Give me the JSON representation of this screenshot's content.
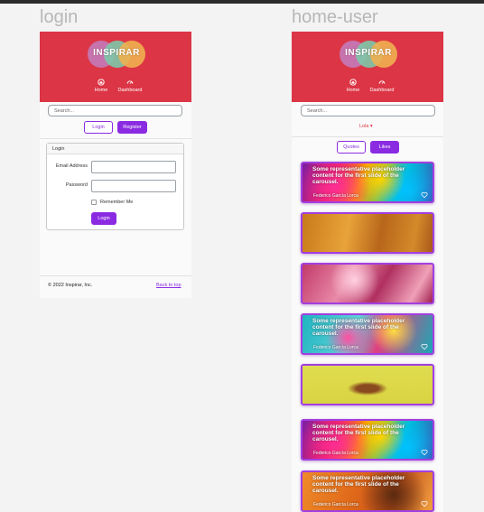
{
  "frames": {
    "login": {
      "title": "login"
    },
    "home": {
      "title": "home-user"
    }
  },
  "brand": {
    "logo_text": "INSPIRAR",
    "colors": {
      "hero": "#dc3545",
      "accent": "#8a2be2"
    }
  },
  "nav": {
    "home_label": "Home",
    "dashboard_label": "Dashboard"
  },
  "search": {
    "placeholder": "Search..."
  },
  "login_page": {
    "login_button": "Login",
    "register_button": "Register",
    "form": {
      "header": "Login",
      "email_label": "Email Address",
      "password_label": "Password",
      "remember_label": "Remember Me",
      "submit_label": "Login"
    },
    "footer": {
      "copyright": "© 2022 Inspirar, Inc.",
      "back_to_top": "Back to top"
    }
  },
  "home_page": {
    "user_dropdown": "Lola ▾",
    "tabs": {
      "quotes": "Quotes",
      "likes": "Likes"
    },
    "slides": [
      {
        "caption": "Some representative placeholder content for the first slide of the carousel.",
        "author": "Federico García Lorca",
        "style": "rainbow",
        "liked": false
      },
      {
        "caption": "",
        "author": "",
        "style": "orange",
        "liked": false
      },
      {
        "caption": "",
        "author": "",
        "style": "pink",
        "liked": false
      },
      {
        "caption": "Some representative placeholder content for the first slide of the carousel.",
        "author": "Federico García Lorca",
        "style": "teal",
        "liked": false
      },
      {
        "caption": "",
        "author": "",
        "style": "yellow",
        "liked": false
      },
      {
        "caption": "Some representative placeholder content for the first slide of the carousel.",
        "author": "Federico García Lorca",
        "style": "rainbow",
        "liked": false
      },
      {
        "caption": "Some representative placeholder content for the first slide of the carousel.",
        "author": "Federico García Lorca",
        "style": "orange2",
        "liked": false
      }
    ]
  }
}
